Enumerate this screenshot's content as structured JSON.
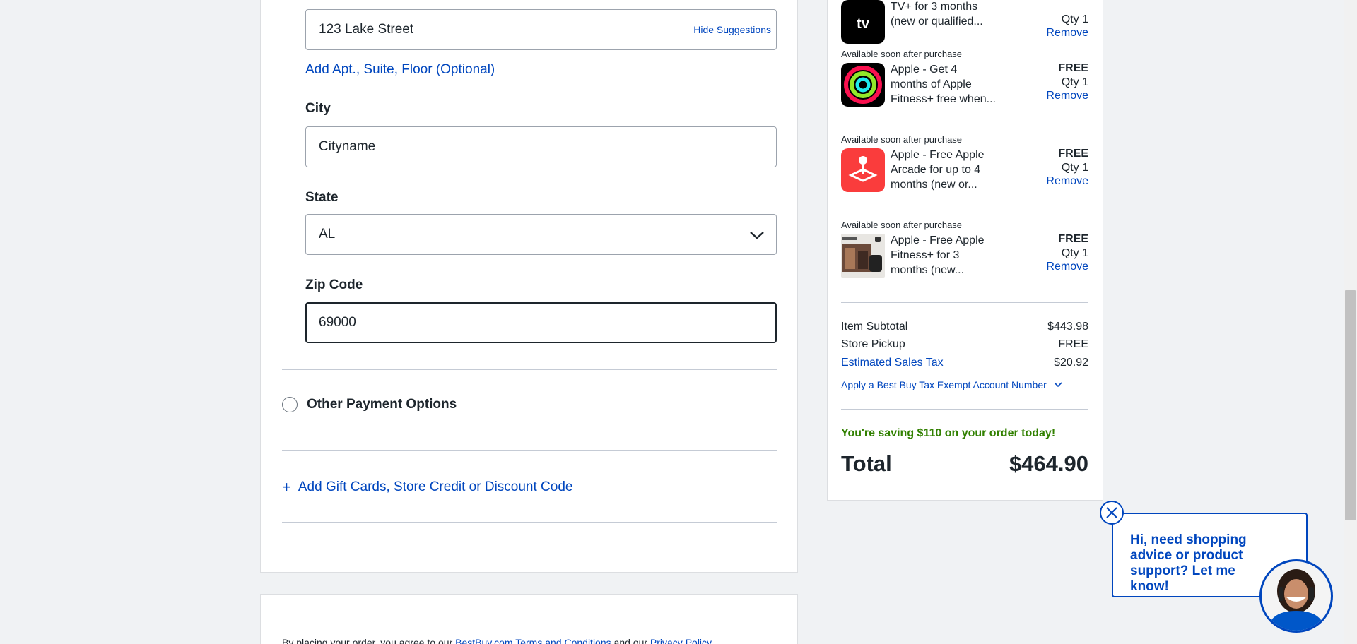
{
  "address": {
    "street_value": "123 Lake Street",
    "hide_suggestions": "Hide Suggestions",
    "add_apt": "Add Apt., Suite, Floor (Optional)",
    "city_label": "City",
    "city_value": "Cityname",
    "state_label": "State",
    "state_value": "AL",
    "zip_label": "Zip Code",
    "zip_value": "69000"
  },
  "payment": {
    "other_options": "Other Payment Options",
    "add_gift": "Add Gift Cards, Store Credit or Discount Code"
  },
  "legal": {
    "prefix": "By placing your order, you agree to our ",
    "terms_link": "BestBuy.com Terms and Conditions",
    "middle": " and our ",
    "privacy_link": "Privacy Policy"
  },
  "order_items": [
    {
      "avail": "",
      "name_lines": [
        "TV+ for 3 months",
        "(new or qualified..."
      ],
      "price": "",
      "qty": "Qty 1",
      "remove": "Remove",
      "icon": "apple-tv-icon"
    },
    {
      "avail": "Available soon after purchase",
      "name_lines": [
        "Apple - Get 4",
        "months of Apple",
        "Fitness+ free when..."
      ],
      "price": "FREE",
      "qty": "Qty 1",
      "remove": "Remove",
      "icon": "apple-fitness-rings-icon"
    },
    {
      "avail": "Available soon after purchase",
      "name_lines": [
        "Apple - Free Apple",
        "Arcade for up to 4",
        "months (new or..."
      ],
      "price": "FREE",
      "qty": "Qty 1",
      "remove": "Remove",
      "icon": "apple-arcade-icon"
    },
    {
      "avail": "Available soon after purchase",
      "name_lines": [
        "Apple - Free Apple",
        "Fitness+ for 3",
        "months (new..."
      ],
      "price": "FREE",
      "qty": "Qty 1",
      "remove": "Remove",
      "icon": "apple-fitness-product-thumbnail"
    }
  ],
  "summary": {
    "subtotal_label": "Item Subtotal",
    "subtotal_value": "$443.98",
    "pickup_label": "Store Pickup",
    "pickup_value": "FREE",
    "tax_label": "Estimated Sales Tax",
    "tax_value": "$20.92",
    "tax_exempt": "Apply a Best Buy Tax Exempt Account Number",
    "savings": "You're saving $110 on your order today!",
    "total_label": "Total",
    "total_value": "$464.90"
  },
  "chat": {
    "message": "Hi, need shopping advice or product support? Let me know!"
  },
  "colors": {
    "accent_blue": "#0046be",
    "savings_green": "#318000",
    "arcade_red": "#fa3c3c"
  }
}
